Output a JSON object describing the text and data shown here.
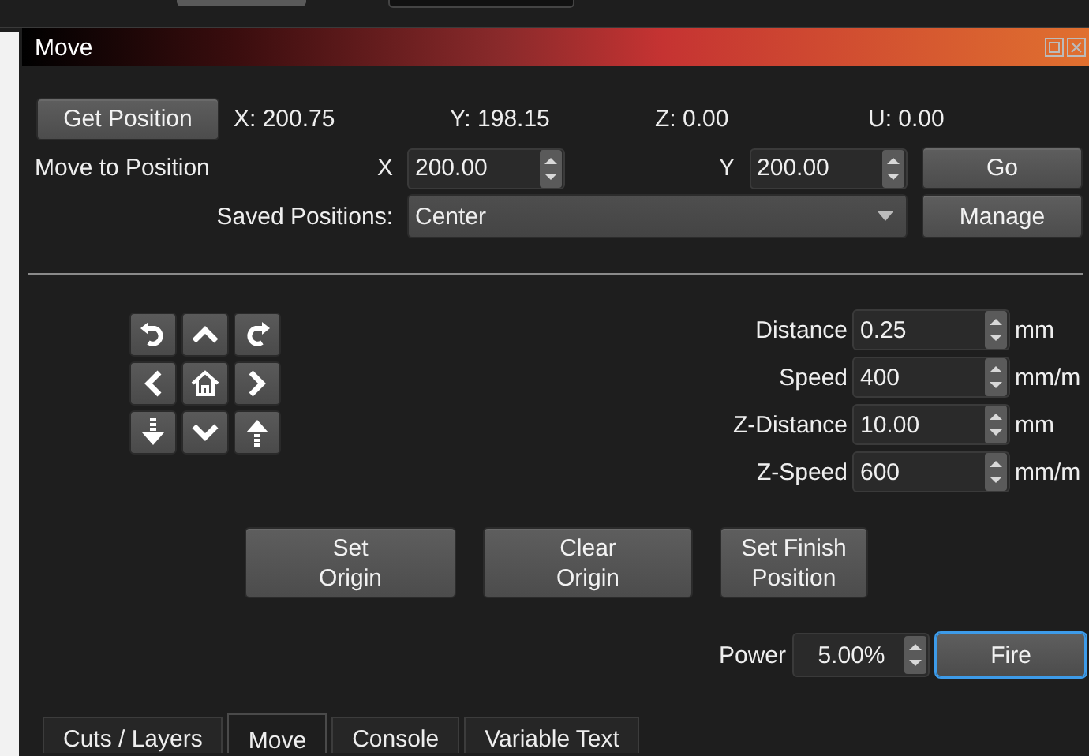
{
  "panel_title": "Move",
  "position": {
    "button": "Get Position",
    "readouts": [
      "X: 200.75",
      "Y: 198.15",
      "Z: 0.00",
      "U: 0.00"
    ]
  },
  "move_to": {
    "label": "Move to Position",
    "x_label": "X",
    "x_value": "200.00",
    "y_label": "Y",
    "y_value": "200.00",
    "go_button": "Go"
  },
  "saved_positions": {
    "label": "Saved Positions:",
    "value": "Center",
    "manage_button": "Manage"
  },
  "jog_buttons": [
    {
      "kind": "rotate-left"
    },
    {
      "kind": "up"
    },
    {
      "kind": "rotate-right"
    },
    {
      "kind": "left"
    },
    {
      "kind": "home"
    },
    {
      "kind": "right"
    },
    {
      "kind": "z-down"
    },
    {
      "kind": "down"
    },
    {
      "kind": "z-up"
    }
  ],
  "settings": [
    {
      "label": "Distance",
      "value": "0.25",
      "unit": "mm"
    },
    {
      "label": "Speed",
      "value": "400",
      "unit": "mm/m"
    },
    {
      "label": "Z-Distance",
      "value": "10.00",
      "unit": "mm"
    },
    {
      "label": "Z-Speed",
      "value": "600",
      "unit": "mm/m"
    }
  ],
  "actions": [
    "Set\nOrigin",
    "Clear\nOrigin",
    "Set Finish\nPosition"
  ],
  "power": {
    "label": "Power",
    "value": "5.00%",
    "fire_button": "Fire",
    "fire_focused": true
  },
  "tabs": [
    {
      "label": "Cuts / Layers",
      "selected": false
    },
    {
      "label": "Move",
      "selected": true
    },
    {
      "label": "Console",
      "selected": false
    },
    {
      "label": "Variable Text",
      "selected": false
    }
  ]
}
